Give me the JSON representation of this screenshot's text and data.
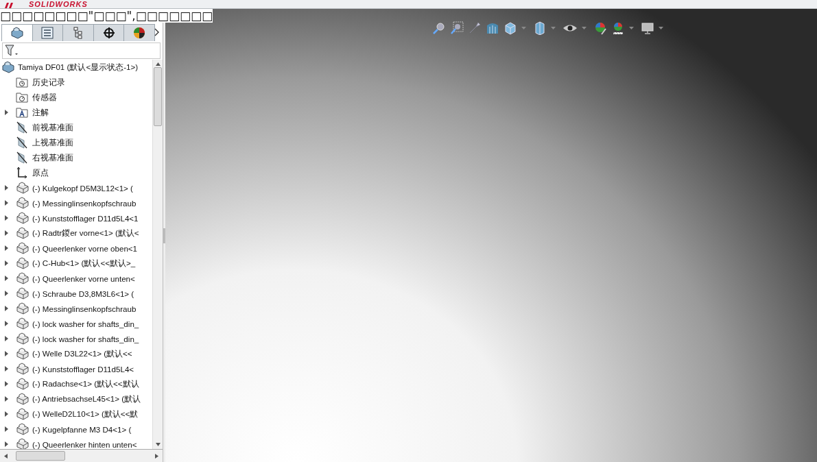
{
  "app": {
    "logo": "SOLIDWORKS"
  },
  "caption": "□□□□□□□□\"□□□\",□□□□□□□",
  "panel_tabs": [
    {
      "selected": true
    },
    {
      "selected": false
    },
    {
      "selected": false
    },
    {
      "selected": false
    },
    {
      "selected": false
    }
  ],
  "tree": {
    "root": {
      "label": "Tamiya DF01  (默认<显示状态-1>)",
      "children": [
        {
          "kind": "history",
          "label": "历史记录",
          "expandable": false
        },
        {
          "kind": "sensor",
          "label": "传感器",
          "expandable": false
        },
        {
          "kind": "annotation",
          "label": "注解",
          "expandable": true
        },
        {
          "kind": "plane",
          "label": "前视基准面",
          "expandable": false
        },
        {
          "kind": "plane",
          "label": "上视基准面",
          "expandable": false
        },
        {
          "kind": "plane",
          "label": "右视基准面",
          "expandable": false
        },
        {
          "kind": "origin",
          "label": "原点",
          "expandable": false
        },
        {
          "kind": "part",
          "label": "(-) Kulgekopf D5M3L12<1> (",
          "expandable": true
        },
        {
          "kind": "part",
          "label": "(-) Messinglinsenkopfschraub",
          "expandable": true
        },
        {
          "kind": "part",
          "label": "(-) Kunststofflager D11d5L4<1",
          "expandable": true
        },
        {
          "kind": "part",
          "label": "(-) Radtr鍐er vorne<1> (默认<",
          "expandable": true
        },
        {
          "kind": "part",
          "label": "(-) Queerlenker vorne oben<1",
          "expandable": true
        },
        {
          "kind": "part",
          "label": "(-) C-Hub<1> (默认<<默认>_",
          "expandable": true
        },
        {
          "kind": "part",
          "label": "(-) Queerlenker vorne unten<",
          "expandable": true
        },
        {
          "kind": "part",
          "label": "(-) Schraube D3,8M3L6<1> (",
          "expandable": true
        },
        {
          "kind": "part",
          "label": "(-) Messinglinsenkopfschraub",
          "expandable": true
        },
        {
          "kind": "part",
          "label": "(-) lock washer for shafts_din_",
          "expandable": true
        },
        {
          "kind": "part",
          "label": "(-) lock washer for shafts_din_",
          "expandable": true
        },
        {
          "kind": "part",
          "label": "(-) Welle D3L22<1> (默认<<",
          "expandable": true
        },
        {
          "kind": "part",
          "label": "(-) Kunststofflager D11d5L4<",
          "expandable": true
        },
        {
          "kind": "part",
          "label": "(-) Radachse<1> (默认<<默认",
          "expandable": true
        },
        {
          "kind": "part",
          "label": "(-) AntriebsachseL45<1> (默认",
          "expandable": true
        },
        {
          "kind": "part",
          "label": "(-) WelleD2L10<1> (默认<<默",
          "expandable": true
        },
        {
          "kind": "part",
          "label": "(-) Kugelpfanne M3 D4<1> (",
          "expandable": true
        },
        {
          "kind": "part",
          "label": "(-) Queerlenker hinten unten<",
          "expandable": true
        }
      ]
    }
  }
}
